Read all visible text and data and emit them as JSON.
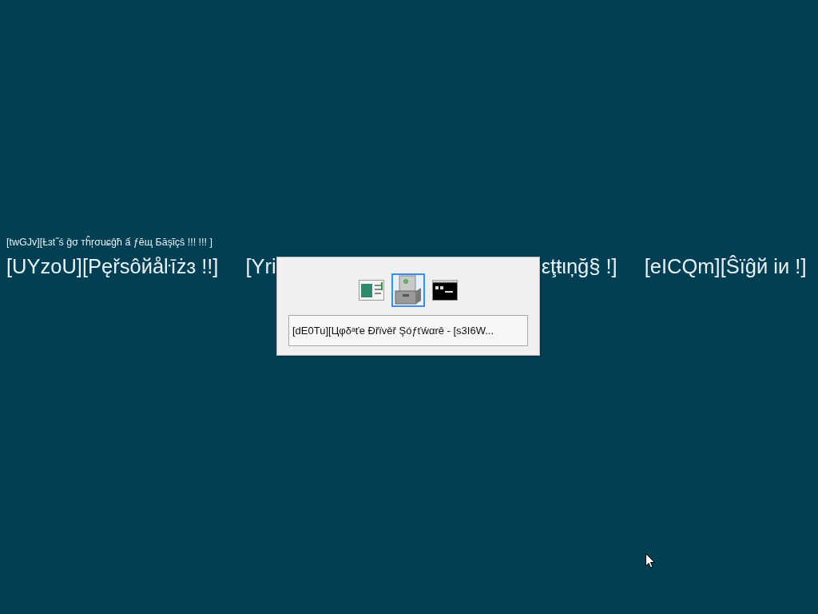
{
  "subtitle": "[twGJv][Ƚɜt˝ś ĝσ тĥŗσuɕĝħ ấ ƒĕщ Бāşῖçŝ !!! !!! ]",
  "headings": [
    {
      "kind": "full",
      "label": "[UYzoU][Pęřsôйåŀīżɜ !!]"
    },
    {
      "kind": "split",
      "label_start": "[Yri",
      "label_end": "εţŧιņğ§ !]"
    },
    {
      "kind": "full",
      "label": "[eICQm][Ŝïĝй iи !]"
    }
  ],
  "switcher": {
    "apps": [
      {
        "kind": "window",
        "selected": false
      },
      {
        "kind": "tools",
        "selected": true
      },
      {
        "kind": "console",
        "selected": false
      }
    ],
    "title": "[dE0Tu][Цφδᵃťe Đřïvěř Şóƒťẃαrê - [s3I6W..."
  }
}
